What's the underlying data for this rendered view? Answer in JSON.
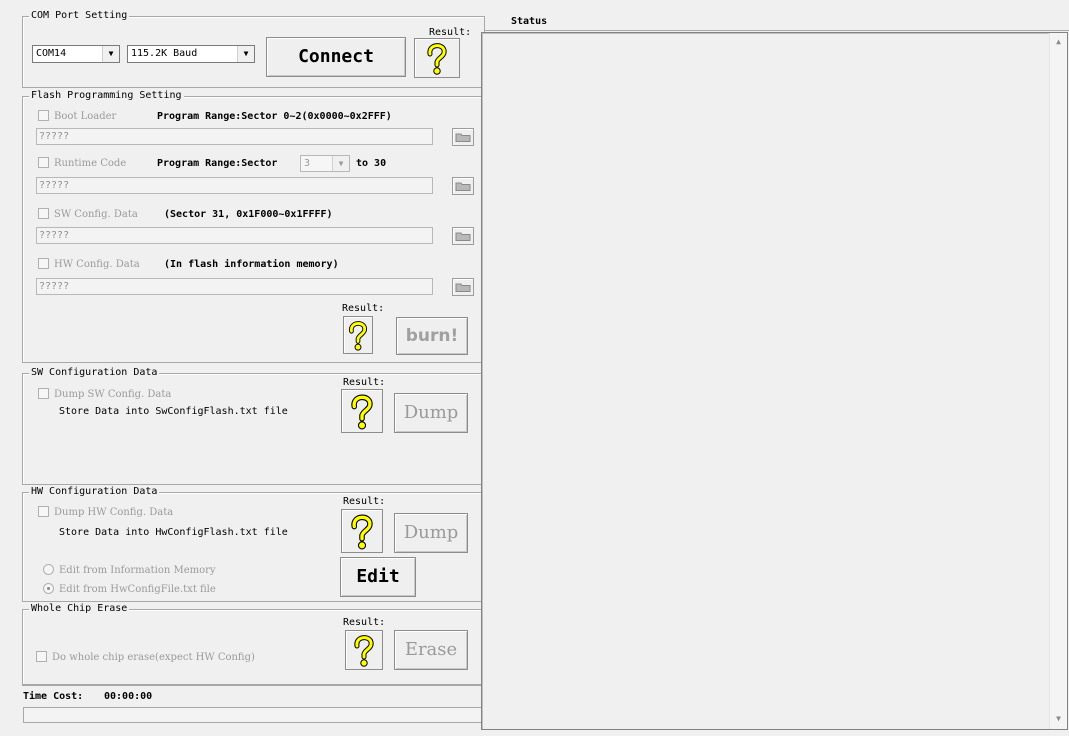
{
  "com_port": {
    "title": "COM Port Setting",
    "port_value": "COM14",
    "baud_value": "115.2K Baud",
    "connect_label": "Connect",
    "result_label": "Result:"
  },
  "flash": {
    "title": "Flash Programming Setting",
    "boot_loader": {
      "label": "Boot Loader",
      "range": "Program Range:Sector 0~2(0x0000~0x2FFF)",
      "path": "?????"
    },
    "runtime": {
      "label": "Runtime Code",
      "range_prefix": "Program Range:Sector",
      "sector_start": "3",
      "range_suffix": "to 30",
      "path": "?????"
    },
    "sw_config": {
      "label": "SW Config. Data",
      "range": "(Sector 31, 0x1F000~0x1FFFF)",
      "path": "?????"
    },
    "hw_config": {
      "label": "HW Config. Data",
      "range": "(In flash information memory)",
      "path": "?????"
    },
    "result_label": "Result:",
    "burn_label": "burn!"
  },
  "sw_data": {
    "title": "SW Configuration Data",
    "dump_label": "Dump SW Config. Data",
    "store_text": "Store Data into SwConfigFlash.txt file",
    "result_label": "Result:",
    "button_label": "Dump"
  },
  "hw_data": {
    "title": "HW Configuration Data",
    "dump_label": "Dump HW Config. Data",
    "store_text": "Store Data into HwConfigFlash.txt file",
    "result_label": "Result:",
    "button_label": "Dump",
    "radio_info": "Edit from Information Memory",
    "radio_file": "Edit from HwConfigFile.txt file",
    "edit_label": "Edit"
  },
  "erase": {
    "title": "Whole Chip Erase",
    "result_label": "Result:",
    "checkbox_label": "Do whole chip erase(expect HW Config)",
    "button_label": "Erase"
  },
  "time_cost": {
    "label": "Time Cost:",
    "value": "00:00:00",
    "progress": 0
  },
  "status": {
    "title": "Status"
  }
}
